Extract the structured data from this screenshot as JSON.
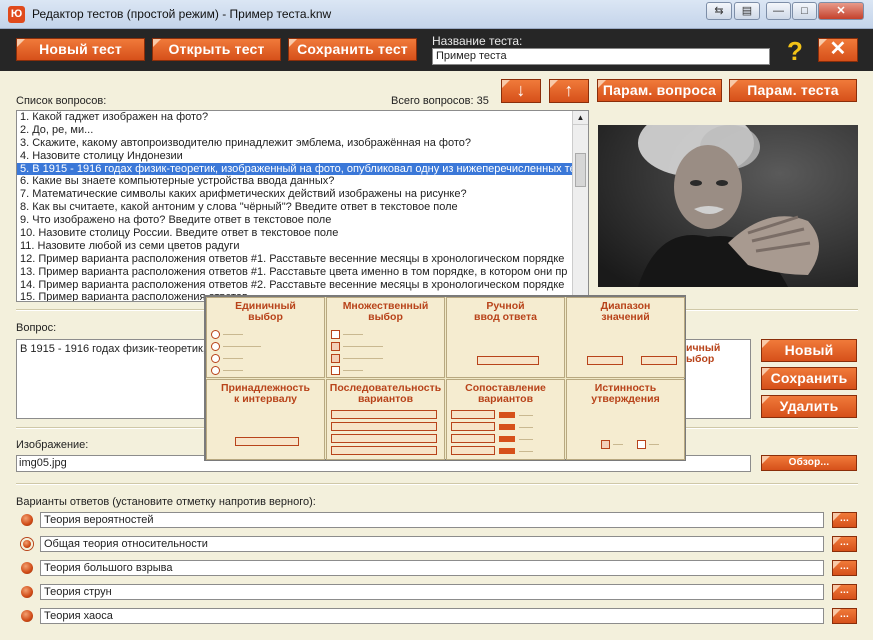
{
  "window": {
    "title": "Редактор тестов (простой режим) - Пример теста.knw",
    "app_icon": "logo-icon",
    "controls": [
      "switch-icon",
      "restore-view-icon",
      "minimize-icon",
      "maximize-icon",
      "close-icon"
    ]
  },
  "toolbar": {
    "new_test": "Новый тест",
    "open_test": "Открыть тест",
    "save_test": "Сохранить тест",
    "test_name_label": "Название теста:",
    "test_name_value": "Пример теста",
    "help": "?",
    "close": "✕"
  },
  "questions": {
    "list_label": "Список вопросов:",
    "total_label": "Всего вопросов: 35",
    "move_down": "↓",
    "move_up": "↑",
    "question_params": "Парам. вопроса",
    "test_params": "Парам. теста",
    "selected_index": 4,
    "items": [
      "1. Какой гаджет изображен на фото?",
      "2. До, ре, ми...",
      "3. Скажите, какому автопроизводителю принадлежит эмблема, изображённая на фото?",
      "4. Назовите столицу Индонезии",
      "5. В 1915 - 1916 годах физик-теоретик, изображенный на фото, опубликовал одну из нижеперечисленных те",
      "6. Какие вы знаете компьютерные устройства ввода данных?",
      "7. Математические символы каких арифметических действий изображены на рисунке?",
      "8. Как вы считаете, какой антоним у слова \"чёрный\"? Введите ответ в текстовое поле",
      "9. Что изображено на фото? Введите ответ в текстовое поле",
      "10. Назовите столицу России. Введите ответ в текстовое поле",
      "11. Назовите любой из семи цветов радуги",
      "12. Пример варианта расположения ответов #1. Расставьте весенние месяцы в хронологическом порядке",
      "13. Пример варианта расположения ответов #1. Расставьте цвета именно в том порядке, в котором они пр",
      "14. Пример варианта расположения ответов #2. Расставьте весенние месяцы в хронологическом порядке",
      "15. Пример варианта расположения ответов"
    ]
  },
  "question": {
    "label": "Вопрос:",
    "text": "В 1915 - 1916 годах физик-теоретик,",
    "type_fragment": "ичный\nыбор",
    "new": "Новый",
    "save": "Сохранить",
    "delete": "Удалить"
  },
  "image": {
    "label": "Изображение:",
    "value": "img05.jpg",
    "browse": "Обзор..."
  },
  "answers": {
    "label": "Варианты ответов (установите отметку напротив верного):",
    "more": "...",
    "items": [
      {
        "text": "Теория вероятностей"
      },
      {
        "text": "Общая теория относительности"
      },
      {
        "text": "Теория большого взрыва"
      },
      {
        "text": "Теория струн"
      },
      {
        "text": "Теория хаоса"
      }
    ]
  },
  "type_popup": {
    "close": "✖",
    "types": [
      {
        "title": "Единичный\nвыбор"
      },
      {
        "title": "Множественный\nвыбор"
      },
      {
        "title": "Ручной\nввод ответа"
      },
      {
        "title": "Диапазон\nзначений"
      },
      {
        "title": "Принадлежность\nк интервалу"
      },
      {
        "title": "Последовательность\nвариантов"
      },
      {
        "title": "Сопоставление\nвариантов"
      },
      {
        "title": "Истинность\nутверждения"
      }
    ]
  },
  "colors": {
    "accent_orange": "#d6501a",
    "header_dark": "#262626",
    "panel_beige": "#f3f0dc",
    "selection_blue": "#3b78d8",
    "help_yellow": "#f3c317"
  }
}
